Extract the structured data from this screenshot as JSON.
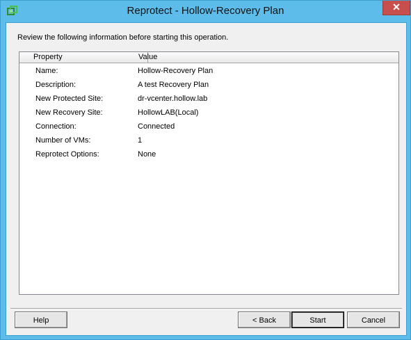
{
  "window": {
    "title": "Reprotect - Hollow-Recovery Plan",
    "close_label": "✕"
  },
  "intro_text": "Review the following information before starting this operation.",
  "table": {
    "columns": [
      "Property",
      "Value"
    ],
    "rows": [
      {
        "property": "Name:",
        "value": "Hollow-Recovery Plan"
      },
      {
        "property": "Description:",
        "value": "A test Recovery Plan"
      },
      {
        "property": "New Protected Site:",
        "value": "dr-vcenter.hollow.lab"
      },
      {
        "property": "New Recovery Site:",
        "value": "HollowLAB(Local)"
      },
      {
        "property": "Connection:",
        "value": "Connected"
      },
      {
        "property": "Number of VMs:",
        "value": "1"
      },
      {
        "property": "Reprotect Options:",
        "value": "None"
      }
    ]
  },
  "buttons": {
    "help": "Help",
    "back": "< Back",
    "start": "Start",
    "cancel": "Cancel"
  },
  "colors": {
    "title_bar": "#5dbcea",
    "close_button": "#c7504f",
    "app_icon": "#3aa63a"
  },
  "icons": {
    "app": "vmware-srm-icon",
    "close": "close-icon"
  }
}
